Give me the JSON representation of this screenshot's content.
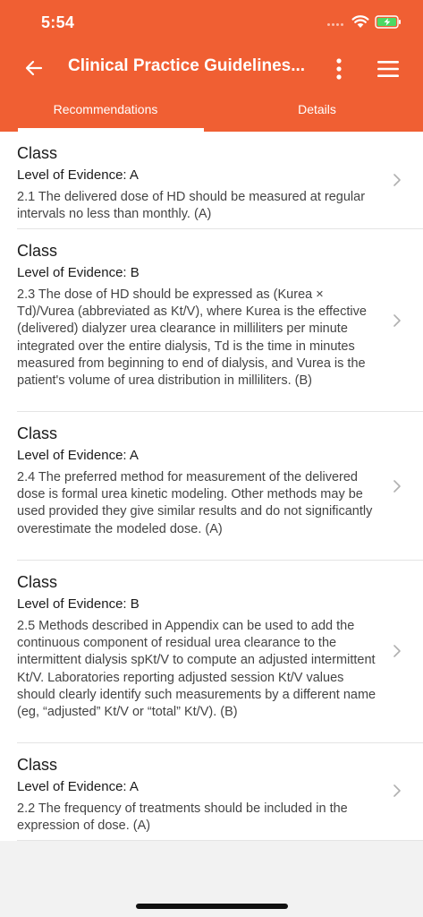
{
  "status": {
    "time": "5:54"
  },
  "toolbar": {
    "title": "Clinical Practice Guidelines..."
  },
  "tabs": [
    {
      "label": "Recommendations"
    },
    {
      "label": "Details"
    }
  ],
  "items": [
    {
      "class_label": "Class",
      "level": "Level of Evidence: A",
      "text": "2.1 The delivered dose of HD should be measured at regular intervals no less than monthly. (A)"
    },
    {
      "class_label": "Class",
      "level": "Level of Evidence: B",
      "text": "2.3 The dose of HD should be expressed as (Kurea × Td)/Vurea (abbreviated as Kt/V), where Kurea is the effective (delivered) dialyzer urea clearance in milliliters per minute integrated over the entire dialysis, Td is the time in minutes measured from beginning to end of dialysis, and Vurea is the patient's volume of urea distribution in milliliters. (B)"
    },
    {
      "class_label": "Class",
      "level": "Level of Evidence: A",
      "text": "2.4 The preferred method for measurement of the delivered dose is formal urea kinetic modeling. Other methods may be used provided they give similar results and do not significantly overestimate the modeled dose. (A)"
    },
    {
      "class_label": "Class",
      "level": "Level of Evidence: B",
      "text": "2.5 Methods described in Appendix can be used to add the continuous component of residual urea clearance to the intermittent dialysis spKt/V to compute an adjusted intermittent Kt/V. Laboratories reporting adjusted session Kt/V values should clearly identify such measurements by a different name (eg, “adjusted” Kt/V or “total” Kt/V). (B)"
    },
    {
      "class_label": "Class",
      "level": "Level of Evidence: A",
      "text": "2.2 The frequency of treatments should be included in the expression of dose. (A)"
    }
  ],
  "colors": {
    "header": "#f05f33",
    "background": "#f2f2f2"
  },
  "icons": [
    "back-arrow-icon",
    "more-vertical-icon",
    "hamburger-menu-icon",
    "chevron-right-icon",
    "wifi-icon",
    "battery-charging-icon"
  ]
}
